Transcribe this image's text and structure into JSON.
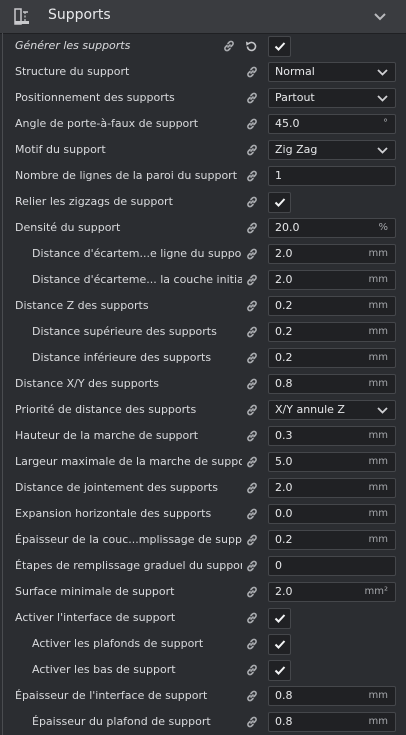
{
  "header": {
    "title": "Supports"
  },
  "rows": [
    {
      "label": "Générer les supports",
      "type": "check",
      "checked": true,
      "italic": true,
      "reset": true
    },
    {
      "label": "Structure du support",
      "type": "dropdown",
      "value": "Normal"
    },
    {
      "label": "Positionnement des supports",
      "type": "dropdown",
      "value": "Partout"
    },
    {
      "label": "Angle de porte-à-faux de support",
      "type": "input",
      "value": "45.0",
      "unit": "°"
    },
    {
      "label": "Motif du support",
      "type": "dropdown",
      "value": "Zig Zag"
    },
    {
      "label": "Nombre de lignes de la paroi du support",
      "type": "input",
      "value": "1",
      "unit": ""
    },
    {
      "label": "Relier les zigzags de support",
      "type": "check",
      "checked": true
    },
    {
      "label": "Densité du support",
      "type": "input",
      "value": "20.0",
      "unit": "%"
    },
    {
      "label": "Distance d'écartem...e ligne du support",
      "type": "input",
      "value": "2.0",
      "unit": "mm",
      "indent": 1
    },
    {
      "label": "Distance d'écarteme... la couche initiale",
      "type": "input",
      "value": "2.0",
      "unit": "mm",
      "indent": 1
    },
    {
      "label": "Distance Z des supports",
      "type": "input",
      "value": "0.2",
      "unit": "mm"
    },
    {
      "label": "Distance supérieure des supports",
      "type": "input",
      "value": "0.2",
      "unit": "mm",
      "indent": 1
    },
    {
      "label": "Distance inférieure des supports",
      "type": "input",
      "value": "0.2",
      "unit": "mm",
      "indent": 1
    },
    {
      "label": "Distance X/Y des supports",
      "type": "input",
      "value": "0.8",
      "unit": "mm"
    },
    {
      "label": "Priorité de distance des supports",
      "type": "dropdown",
      "value": "X/Y annule Z"
    },
    {
      "label": "Hauteur de la marche de support",
      "type": "input",
      "value": "0.3",
      "unit": "mm"
    },
    {
      "label": "Largeur maximale de la marche de support",
      "type": "input",
      "value": "5.0",
      "unit": "mm"
    },
    {
      "label": "Distance de jointement des supports",
      "type": "input",
      "value": "2.0",
      "unit": "mm"
    },
    {
      "label": "Expansion horizontale des supports",
      "type": "input",
      "value": "0.0",
      "unit": "mm"
    },
    {
      "label": "Épaisseur de la couc...mplissage de support",
      "type": "input",
      "value": "0.2",
      "unit": "mm"
    },
    {
      "label": "Étapes de remplissage graduel du support",
      "type": "input",
      "value": "0",
      "unit": ""
    },
    {
      "label": "Surface minimale de support",
      "type": "input",
      "value": "2.0",
      "unit": "mm²"
    },
    {
      "label": "Activer l'interface de support",
      "type": "check",
      "checked": true
    },
    {
      "label": "Activer les plafonds de support",
      "type": "check",
      "checked": true,
      "indent": 1
    },
    {
      "label": "Activer les bas de support",
      "type": "check",
      "checked": true,
      "indent": 1
    },
    {
      "label": "Épaisseur de l'interface de support",
      "type": "input",
      "value": "0.8",
      "unit": "mm"
    },
    {
      "label": "Épaisseur du plafond de support",
      "type": "input",
      "value": "0.8",
      "unit": "mm",
      "indent": 1
    }
  ],
  "colors": {
    "background": "#2b2d31",
    "header": "#3a3c40",
    "field": "#202124",
    "text": "#dcdde0"
  },
  "icons": {
    "section": "support-icon",
    "link": "link-icon",
    "reset": "reset-icon",
    "dropdown": "chevron-down-icon",
    "check": "check-icon"
  }
}
